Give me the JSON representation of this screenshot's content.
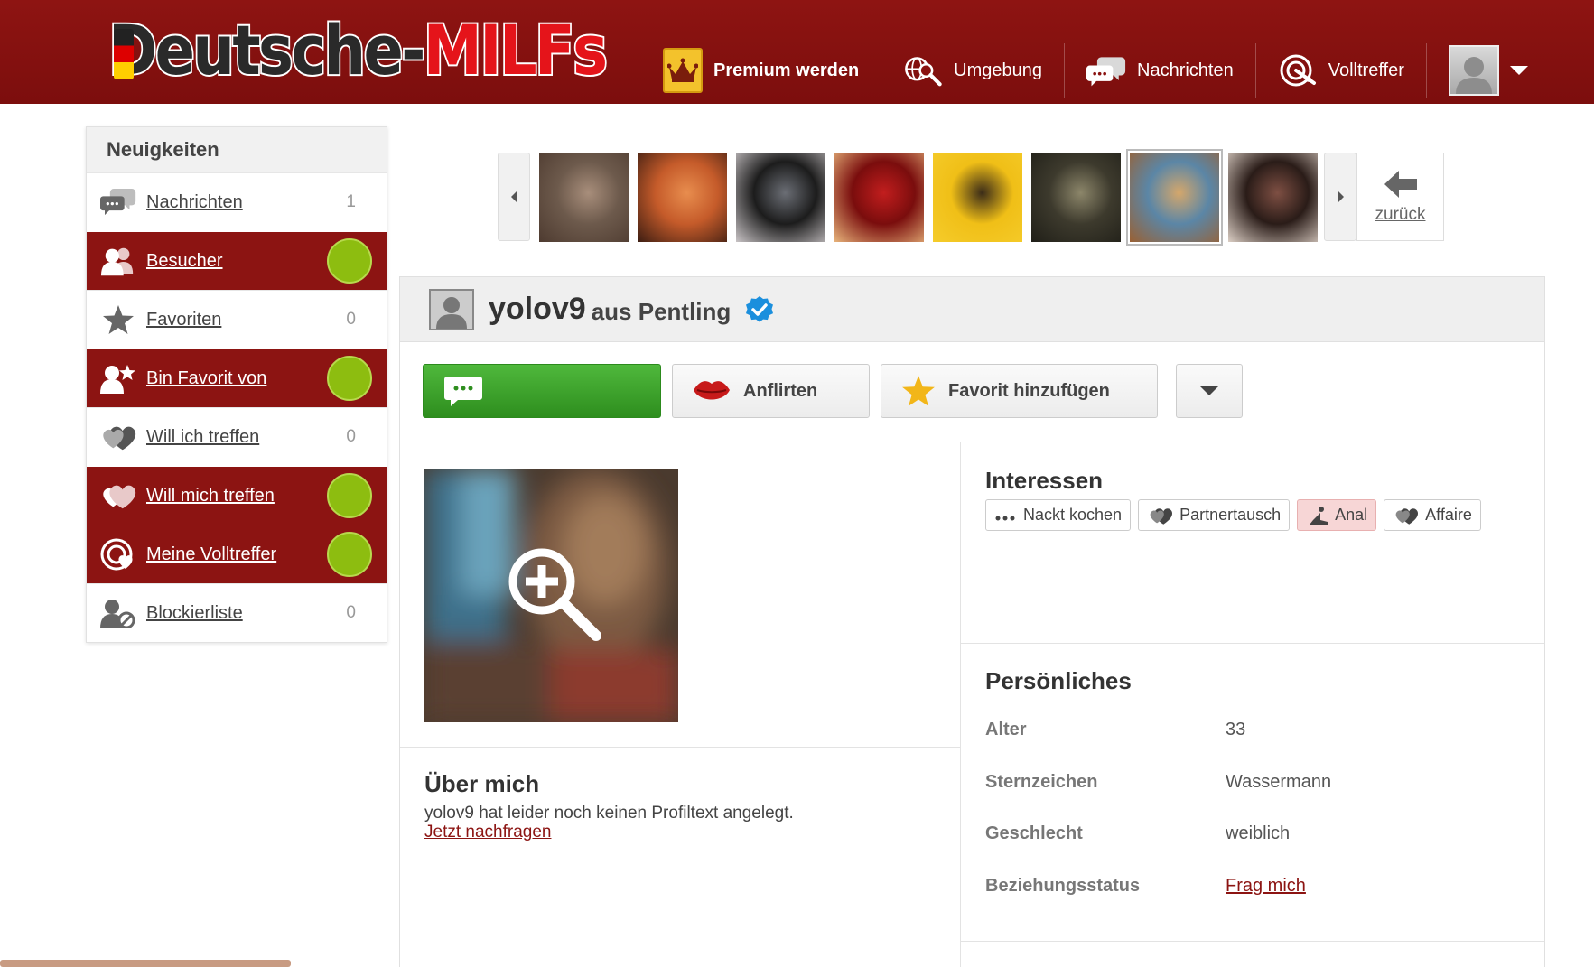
{
  "brand": {
    "logo_part1": "Deutsche-",
    "logo_part2": "MILFs"
  },
  "nav": {
    "premium": "Premium werden",
    "umgebung": "Umgebung",
    "nachrichten": "Nachrichten",
    "volltreffer": "Volltreffer"
  },
  "sidebar": {
    "title": "Neuigkeiten",
    "items": [
      {
        "label": "Nachrichten",
        "count": "1",
        "active": false,
        "icon": "chat-bubbles-icon"
      },
      {
        "label": "Besucher",
        "count": "",
        "active": true,
        "icon": "visitors-icon"
      },
      {
        "label": "Favoriten",
        "count": "0",
        "active": false,
        "icon": "star-icon"
      },
      {
        "label": "Bin Favorit von",
        "count": "",
        "active": true,
        "icon": "user-star-icon"
      },
      {
        "label": "Will ich treffen",
        "count": "0",
        "active": false,
        "icon": "hearts-icon"
      },
      {
        "label": "Will mich treffen",
        "count": "",
        "active": true,
        "icon": "hearts-icon"
      },
      {
        "label": "Meine Volltreffer",
        "count": "",
        "active": true,
        "icon": "target-heart-icon"
      },
      {
        "label": "Blockierliste",
        "count": "0",
        "active": false,
        "icon": "user-blocked-icon"
      }
    ]
  },
  "gallery": {
    "back_label": "zurück",
    "thumb_colors": [
      [
        "#6d5a4c",
        "#a88e7b",
        "#4e3b30"
      ],
      [
        "#c55b2a",
        "#e88d4e",
        "#3c1d12"
      ],
      [
        "#1c1c1c",
        "#6b6e75",
        "#c9c4c6"
      ],
      [
        "#7a0d0d",
        "#c21e1e",
        "#e7b37a"
      ],
      [
        "#f0bf17",
        "#3b2c18",
        "#f5cc2b"
      ],
      [
        "#3d3a2d",
        "#8c866a",
        "#201f18"
      ],
      [
        "#5b86a6",
        "#d5a76b",
        "#9a6032"
      ],
      [
        "#2a1c18",
        "#7e4f43",
        "#dccfc5"
      ]
    ],
    "selected_index": 6
  },
  "profile": {
    "username": "yolov9",
    "location": "aus Pentling",
    "actions": {
      "flirt": "Anflirten",
      "favorite": "Favorit hinzufügen"
    },
    "about": {
      "title": "Über mich",
      "text": "yolov9 hat leider noch keinen Profiltext angelegt.",
      "link": "Jetzt nachfragen"
    },
    "interests": {
      "title": "Interessen",
      "tags": [
        {
          "label": "Nackt kochen",
          "icon": "dots-icon",
          "highlight": false
        },
        {
          "label": "Partnertausch",
          "icon": "hearts-icon",
          "highlight": false
        },
        {
          "label": "Anal",
          "icon": "position-icon",
          "highlight": true
        },
        {
          "label": "Affaire",
          "icon": "hearts-icon",
          "highlight": false
        }
      ]
    },
    "personal": {
      "title": "Persönliches",
      "rows": [
        {
          "label": "Alter",
          "value": "33",
          "link": false
        },
        {
          "label": "Sternzeichen",
          "value": "Wassermann",
          "link": false
        },
        {
          "label": "Geschlecht",
          "value": "weiblich",
          "link": false
        },
        {
          "label": "Beziehungsstatus",
          "value": "Frag mich",
          "link": true
        }
      ]
    }
  },
  "colors": {
    "brand_red": "#8a1210",
    "active_dot": "#8dbd10",
    "green_button": "#3ea52b",
    "verified_blue": "#1b8fdd"
  }
}
